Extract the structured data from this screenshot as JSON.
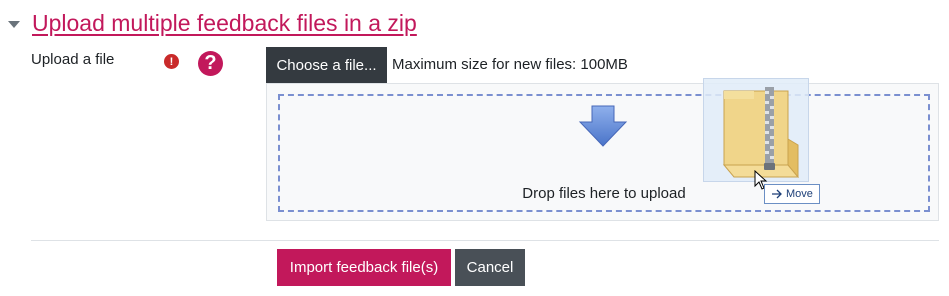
{
  "section": {
    "title": "Upload multiple feedback files in a zip"
  },
  "upload": {
    "label": "Upload a file",
    "required_icon": "!",
    "help_icon": "?",
    "choose_button": "Choose a file...",
    "max_size": "Maximum size for new files: 100MB",
    "drop_text": "Drop files here to upload"
  },
  "drag": {
    "tooltip": "Move"
  },
  "actions": {
    "import_label": "Import feedback file(s)",
    "cancel_label": "Cancel"
  },
  "colors": {
    "accent": "#c2185b",
    "dark_button": "#343a40",
    "cancel_button": "#495057",
    "dropzone_border": "#7a8fd0",
    "required": "#c92a2a"
  },
  "icons": [
    "chevron-down-icon",
    "required-icon",
    "help-icon",
    "down-arrow-icon",
    "zip-folder-icon",
    "cursor-icon",
    "move-arrow-icon"
  ]
}
